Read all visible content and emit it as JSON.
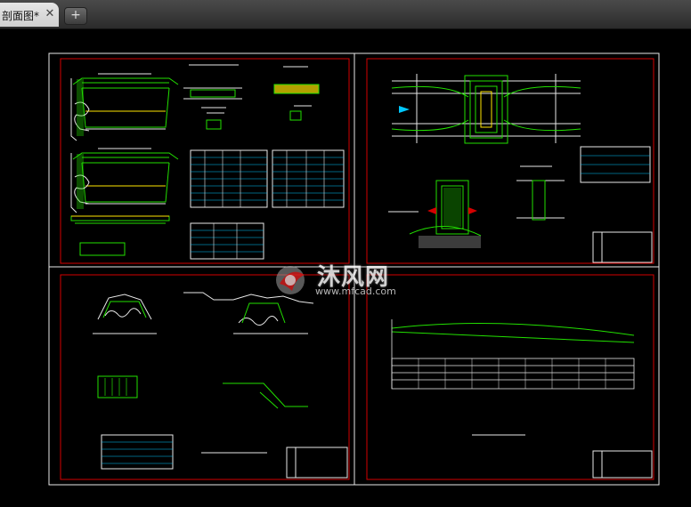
{
  "tabs": [
    {
      "label": "剖面图*",
      "active": true
    }
  ],
  "new_tab_label": "+",
  "close_glyph": "✕",
  "watermark": {
    "text": "沐风网",
    "url": "www.mfcad.com"
  },
  "colors": {
    "canvas": "#000000",
    "sheet_border": "#ffffff",
    "frame": "#d40000",
    "drawing_green": "#22e000",
    "drawing_white": "#e8e8e8",
    "drawing_cyan": "#00c8ff",
    "drawing_yellow": "#ffe600"
  }
}
